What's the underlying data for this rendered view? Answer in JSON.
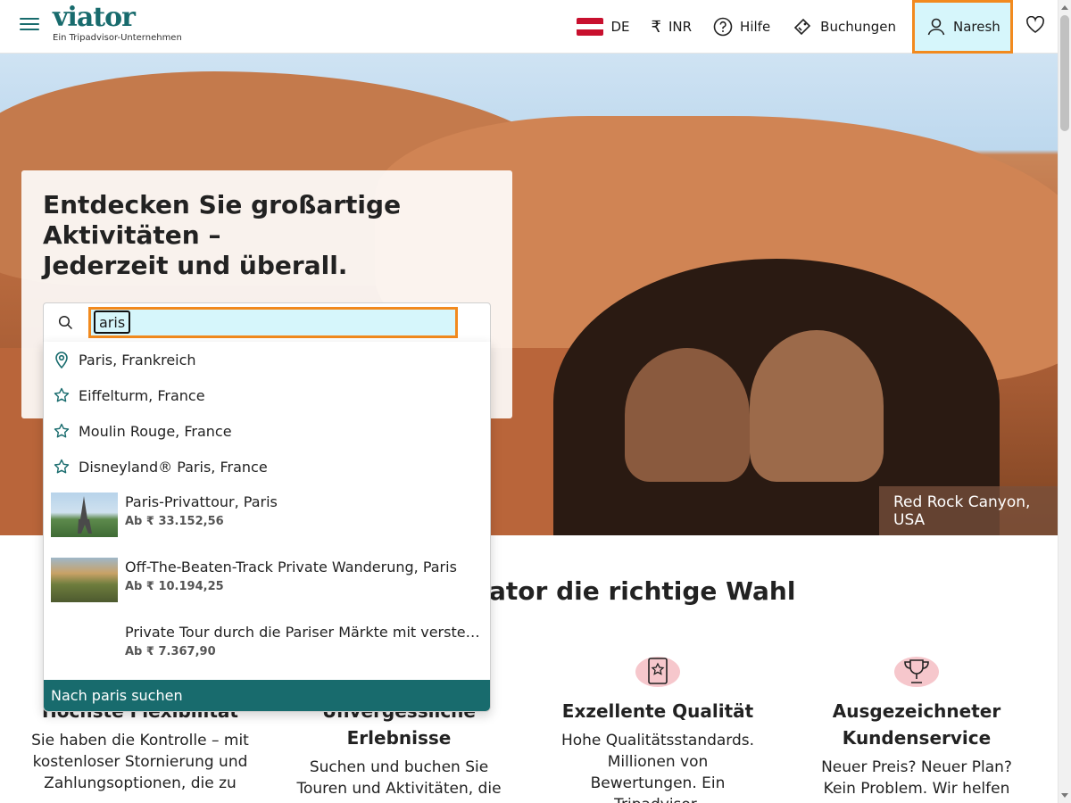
{
  "header": {
    "logo_text": "viator",
    "logo_sub": "Ein Tripadvisor-Unternehmen",
    "nav": {
      "language": "DE",
      "currency_symbol": "₹",
      "currency": "INR",
      "help": "Hilfe",
      "bookings": "Buchungen",
      "user": "Naresh"
    },
    "flag_colors": [
      "#c8102e",
      "#ffffff",
      "#c8102e"
    ],
    "accent": "#186b6d",
    "focus_color": "#f28a1e"
  },
  "hero": {
    "title": "Entdecken Sie großartige\nAktivitäten –\nJederzeit und überall.",
    "caption": "Red Rock Canyon, USA",
    "search": {
      "value": "aris"
    }
  },
  "dropdown": {
    "locations": [
      {
        "icon": "pin-icon",
        "label": "Paris, Frankreich"
      },
      {
        "icon": "star-icon",
        "label": "Eiffelturm, France"
      },
      {
        "icon": "star-icon",
        "label": "Moulin Rouge, France"
      },
      {
        "icon": "star-icon",
        "label": "Disneyland® Paris, France"
      }
    ],
    "products": [
      {
        "title": "Paris-Privattour, Paris",
        "price": "Ab ₹ 33.152,56"
      },
      {
        "title": "Off-The-Beaten-Track Private Wanderung, Paris",
        "price": "Ab ₹ 10.194,25"
      },
      {
        "title": "Private Tour durch die Pariser Märkte mit verstec...",
        "price": "Ab ₹ 7.367,90"
      }
    ],
    "footer": "Nach paris suchen"
  },
  "section": {
    "title_fragment": "ator die richtige Wahl",
    "features": [
      {
        "icon": "calendar-icon",
        "title": "Höchste Flexibilität",
        "desc": "Sie haben die Kontrolle – mit kostenloser Stornierung und Zahlungsoptionen, die zu"
      },
      {
        "icon": "ticket-icon",
        "title": "Unvergessliche Erlebnisse",
        "desc": "Suchen und buchen Sie Touren und Aktivitäten, die so"
      },
      {
        "icon": "badge-star-icon",
        "title": "Exzellente Qualität",
        "desc": "Hohe Qualitätsstandards. Millionen von Bewertungen. Ein Tripadvisor-"
      },
      {
        "icon": "trophy-icon",
        "title": "Ausgezeichneter Kundenservice",
        "desc": "Neuer Preis? Neuer Plan? Kein Problem. Wir helfen Ihnen"
      }
    ]
  }
}
